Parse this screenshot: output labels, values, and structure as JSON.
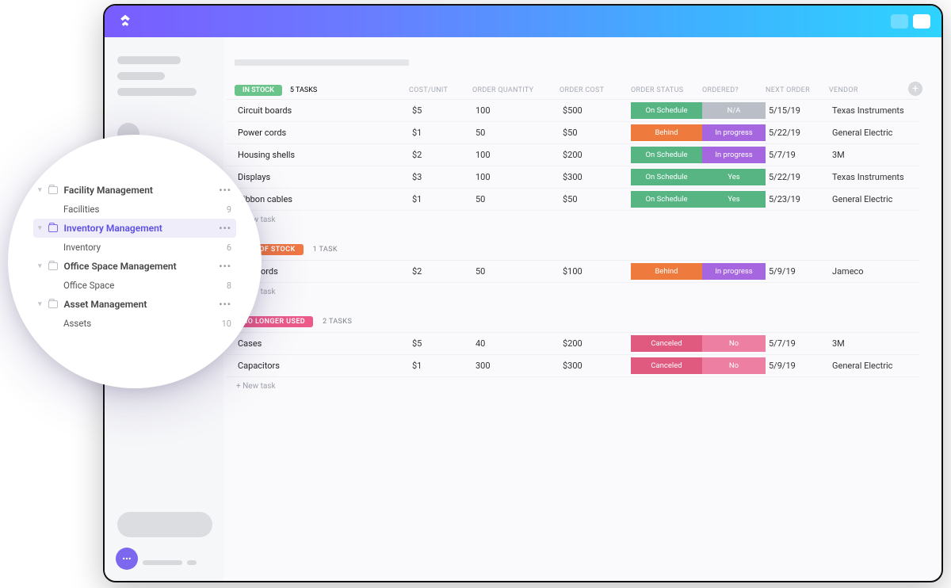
{
  "columns": [
    "COST/UNIT",
    "ORDER QUANTITY",
    "ORDER COST",
    "ORDER STATUS",
    "ORDERED?",
    "NEXT ORDER",
    "VENDOR"
  ],
  "groups": [
    {
      "badge_label": "IN STOCK",
      "badge_class": "green",
      "task_count": "5 TASKS",
      "rows": [
        {
          "name": "Circuit boards",
          "cost": "$5",
          "qty": "100",
          "ocost": "$500",
          "status": "On Schedule",
          "status_cls": "st-green",
          "ordered": "N/A",
          "ordered_cls": "st-grey",
          "next": "5/15/19",
          "vendor": "Texas Instruments"
        },
        {
          "name": "Power cords",
          "cost": "$1",
          "qty": "50",
          "ocost": "$50",
          "status": "Behind",
          "status_cls": "st-orange",
          "ordered": "In progress",
          "ordered_cls": "st-purple",
          "next": "5/22/19",
          "vendor": "General Electric"
        },
        {
          "name": "Housing shells",
          "cost": "$2",
          "qty": "100",
          "ocost": "$200",
          "status": "On Schedule",
          "status_cls": "st-green",
          "ordered": "In progress",
          "ordered_cls": "st-purple",
          "next": "5/7/19",
          "vendor": "3M"
        },
        {
          "name": "Displays",
          "cost": "$3",
          "qty": "100",
          "ocost": "$300",
          "status": "On Schedule",
          "status_cls": "st-green",
          "ordered": "Yes",
          "ordered_cls": "st-green",
          "next": "5/22/19",
          "vendor": "Texas Instruments"
        },
        {
          "name": "Ribbon cables",
          "cost": "$1",
          "qty": "50",
          "ocost": "$50",
          "status": "On Schedule",
          "status_cls": "st-green",
          "ordered": "Yes",
          "ordered_cls": "st-green",
          "next": "5/23/19",
          "vendor": "General Electric"
        }
      ]
    },
    {
      "badge_label": "OUT OF STOCK",
      "badge_class": "orange",
      "task_count": "1 TASK",
      "rows": [
        {
          "name": "USB cords",
          "cost": "$2",
          "qty": "50",
          "ocost": "$100",
          "status": "Behind",
          "status_cls": "st-orange",
          "ordered": "In progress",
          "ordered_cls": "st-purple",
          "next": "5/9/19",
          "vendor": "Jameco"
        }
      ]
    },
    {
      "badge_label": "NO LONGER USED",
      "badge_class": "pink",
      "task_count": "2 TASKS",
      "rows": [
        {
          "name": "Cases",
          "cost": "$5",
          "qty": "40",
          "ocost": "$200",
          "status": "Canceled",
          "status_cls": "st-red",
          "ordered": "No",
          "ordered_cls": "st-pink",
          "next": "5/7/19",
          "vendor": "3M"
        },
        {
          "name": "Capacitors",
          "cost": "$1",
          "qty": "300",
          "ocost": "$300",
          "status": "Canceled",
          "status_cls": "st-red",
          "ordered": "No",
          "ordered_cls": "st-pink",
          "next": "5/9/19",
          "vendor": "General Electric"
        }
      ]
    }
  ],
  "newtask_label": "+ New task",
  "sidebar_folders": [
    {
      "name": "Facility Management",
      "children": [
        {
          "name": "Facilities",
          "count": "9"
        }
      ]
    },
    {
      "name": "Inventory Management",
      "active": true,
      "children": [
        {
          "name": "Inventory",
          "count": "6"
        }
      ]
    },
    {
      "name": "Office Space Management",
      "children": [
        {
          "name": "Office Space",
          "count": "8"
        }
      ]
    },
    {
      "name": "Asset Management",
      "children": [
        {
          "name": "Assets",
          "count": "10"
        }
      ]
    }
  ]
}
